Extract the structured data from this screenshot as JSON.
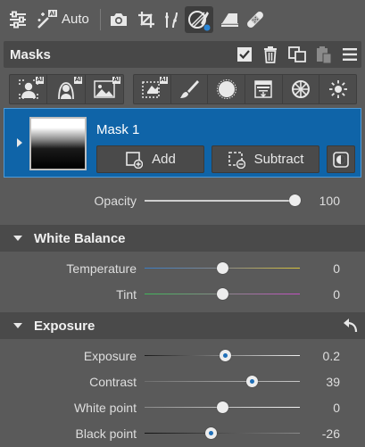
{
  "toolbar": {
    "auto_label": "Auto",
    "icons": [
      "sliders-icon",
      "magic-wand-ai-icon",
      "camera-icon",
      "crop-icon",
      "curves-icon",
      "mask-brush-icon",
      "eraser-icon",
      "bandage-icon"
    ]
  },
  "masks": {
    "title": "Masks",
    "checkbox_checked": true
  },
  "tools": {
    "ai_badge": "AI",
    "left_group": [
      "ai-person-icon",
      "ai-portrait-icon",
      "ai-landscape-icon"
    ],
    "right_group": [
      "ai-select-icon",
      "brush-icon",
      "radial-icon",
      "gradient-icon",
      "color-range-icon",
      "luminosity-icon"
    ]
  },
  "mask_item": {
    "name": "Mask 1",
    "add_label": "Add",
    "subtract_label": "Subtract"
  },
  "opacity": {
    "label": "Opacity",
    "value": "100",
    "level": 1.0
  },
  "white_balance": {
    "title": "White Balance",
    "rows": [
      {
        "label": "Temperature",
        "value": "0",
        "level": 0.5
      },
      {
        "label": "Tint",
        "value": "0",
        "level": 0.5
      }
    ]
  },
  "exposure": {
    "title": "Exposure",
    "rows": [
      {
        "label": "Exposure",
        "value": "0.2",
        "level": 0.52
      },
      {
        "label": "Contrast",
        "value": "39",
        "level": 0.69
      },
      {
        "label": "White point",
        "value": "0",
        "level": 0.5
      },
      {
        "label": "Black point",
        "value": "-26",
        "level": 0.43
      }
    ]
  },
  "colors": {
    "accent": "#0f64a8",
    "thumb_dot": "#1f6fb8"
  }
}
